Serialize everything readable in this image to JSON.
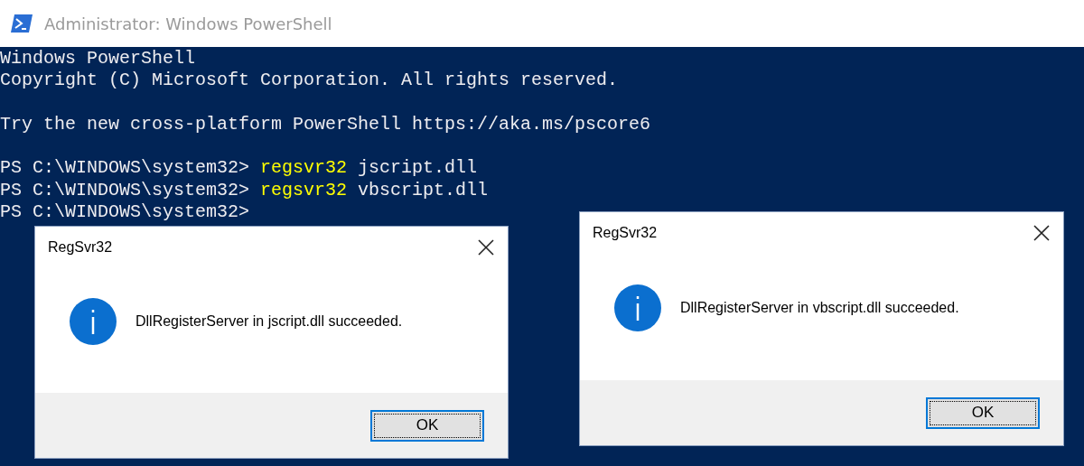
{
  "window": {
    "title": "Administrator: Windows PowerShell"
  },
  "console": {
    "blocks": [
      {
        "lines": [
          [
            {
              "kind": "output",
              "text": "Windows PowerShell"
            }
          ],
          [
            {
              "kind": "output",
              "text": "Copyright (C) Microsoft Corporation. All rights reserved."
            }
          ]
        ]
      },
      {
        "lines": [
          [
            {
              "kind": "output",
              "text": "Try the new cross-platform PowerShell https://aka.ms/pscore6"
            }
          ]
        ]
      },
      {
        "lines": [
          [
            {
              "kind": "prompt",
              "text": "PS C:\\WINDOWS\\system32>"
            },
            {
              "kind": "command",
              "text": "regsvr32"
            },
            {
              "kind": "argument",
              "text": "jscript.dll"
            }
          ],
          [
            {
              "kind": "prompt",
              "text": "PS C:\\WINDOWS\\system32>"
            },
            {
              "kind": "command",
              "text": "regsvr32"
            },
            {
              "kind": "argument",
              "text": "vbscript.dll"
            }
          ],
          [
            {
              "kind": "prompt",
              "text": "PS C:\\WINDOWS\\system32>"
            }
          ]
        ]
      }
    ]
  },
  "dialogs": [
    {
      "title": "RegSvr32",
      "message": "DllRegisterServer in jscript.dll succeeded.",
      "button": {
        "label": "OK",
        "focused": true
      }
    },
    {
      "title": "RegSvr32",
      "message": "DllRegisterServer in vbscript.dll succeeded.",
      "button": {
        "label": "OK",
        "focused": true
      }
    }
  ]
}
